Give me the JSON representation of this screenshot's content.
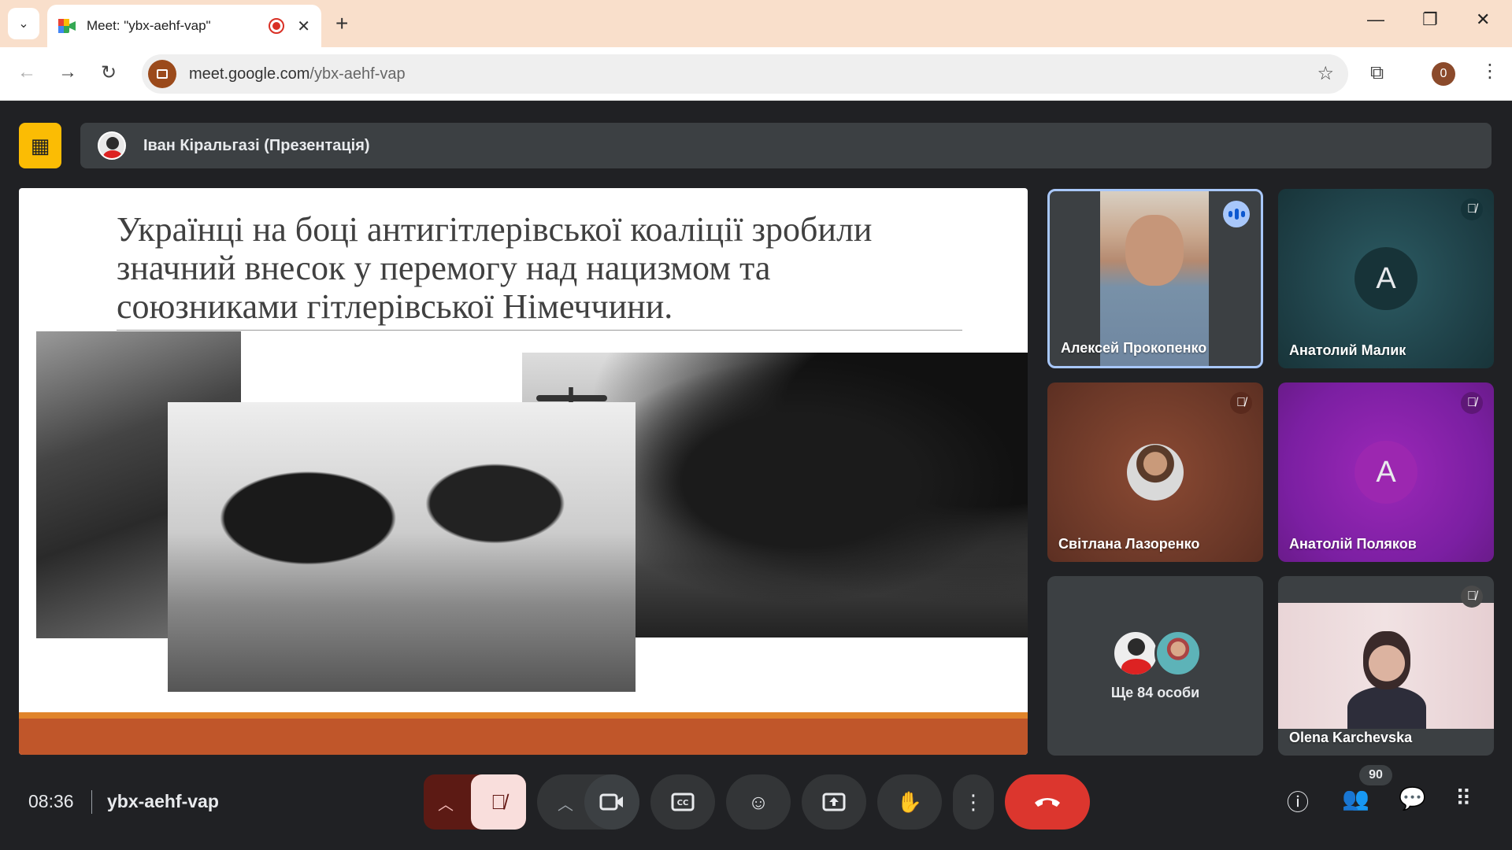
{
  "browser": {
    "tab_title": "Meet: \"ybx-aehf-vap\"",
    "url_host": "meet.google.com",
    "url_path": "/ybx-aehf-vap",
    "profile_initial": "0"
  },
  "presentation": {
    "presenter": "Іван Кіральгазі (Презентація)",
    "slide_title": "Українці на боці антигітлерівської коаліції зробили значний внесок у перемогу над нацизмом та союзниками гітлерівської Німеччини."
  },
  "participants": [
    {
      "name": "Алексей Прокопенко",
      "speaking": true
    },
    {
      "name": "Анатолий Малик",
      "initial": "A",
      "muted": true
    },
    {
      "name": "Світлана Лазоренко",
      "muted": true
    },
    {
      "name": "Анатолій Поляков",
      "initial": "A",
      "muted": true
    },
    {
      "name": "Olena Karchevska",
      "muted": true
    }
  ],
  "more_participants": "Ще 84 особи",
  "meeting": {
    "time": "08:36",
    "code": "ybx-aehf-vap",
    "people_count": "90"
  },
  "colors": {
    "tab_bar": "#f9dfcb",
    "end_call": "#dc362e",
    "mic_off": "#f9dedc",
    "present_icon": "#fbbc04"
  }
}
